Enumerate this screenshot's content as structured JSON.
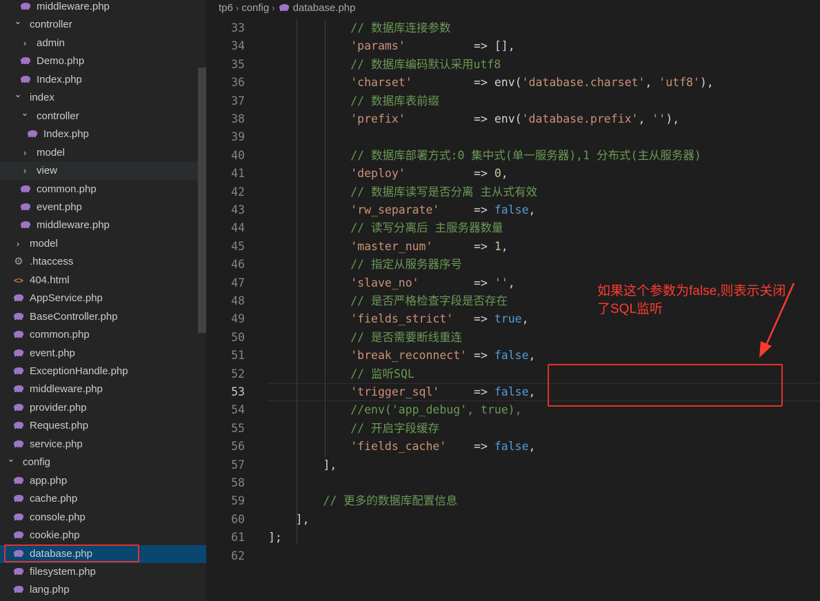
{
  "sidebar": {
    "items": [
      {
        "label": "middleware.php",
        "type": "php",
        "indent": 2
      },
      {
        "label": "controller",
        "type": "folder-open",
        "indent": 1
      },
      {
        "label": "admin",
        "type": "folder-closed",
        "indent": 2
      },
      {
        "label": "Demo.php",
        "type": "php",
        "indent": 2
      },
      {
        "label": "Index.php",
        "type": "php",
        "indent": 2
      },
      {
        "label": "index",
        "type": "folder-open",
        "indent": 1
      },
      {
        "label": "controller",
        "type": "folder-open",
        "indent": 2
      },
      {
        "label": "Index.php",
        "type": "php",
        "indent": 3
      },
      {
        "label": "model",
        "type": "folder-closed",
        "indent": 2
      },
      {
        "label": "view",
        "type": "folder-closed",
        "indent": 2
      },
      {
        "label": "common.php",
        "type": "php",
        "indent": 2
      },
      {
        "label": "event.php",
        "type": "php",
        "indent": 2
      },
      {
        "label": "middleware.php",
        "type": "php",
        "indent": 2
      },
      {
        "label": "model",
        "type": "folder-closed",
        "indent": 1
      },
      {
        "label": ".htaccess",
        "type": "gear",
        "indent": 1
      },
      {
        "label": "404.html",
        "type": "html",
        "indent": 1
      },
      {
        "label": "AppService.php",
        "type": "php",
        "indent": 1
      },
      {
        "label": "BaseController.php",
        "type": "php",
        "indent": 1
      },
      {
        "label": "common.php",
        "type": "php",
        "indent": 1
      },
      {
        "label": "event.php",
        "type": "php",
        "indent": 1
      },
      {
        "label": "ExceptionHandle.php",
        "type": "php",
        "indent": 1
      },
      {
        "label": "middleware.php",
        "type": "php",
        "indent": 1
      },
      {
        "label": "provider.php",
        "type": "php",
        "indent": 1
      },
      {
        "label": "Request.php",
        "type": "php",
        "indent": 1
      },
      {
        "label": "service.php",
        "type": "php",
        "indent": 1
      },
      {
        "label": "config",
        "type": "folder-open",
        "indent": 0
      },
      {
        "label": "app.php",
        "type": "php",
        "indent": 1
      },
      {
        "label": "cache.php",
        "type": "php",
        "indent": 1
      },
      {
        "label": "console.php",
        "type": "php",
        "indent": 1
      },
      {
        "label": "cookie.php",
        "type": "php",
        "indent": 1
      },
      {
        "label": "database.php",
        "type": "php",
        "indent": 1,
        "selected": true
      },
      {
        "label": "filesystem.php",
        "type": "php",
        "indent": 1
      },
      {
        "label": "lang.php",
        "type": "php",
        "indent": 1
      }
    ]
  },
  "breadcrumb": [
    "tp6",
    "config",
    "database.php"
  ],
  "code": [
    {
      "n": "33",
      "tokens": [
        [
          "c-comment",
          "            // 数据库连接参数"
        ]
      ]
    },
    {
      "n": "34",
      "tokens": [
        [
          "c-plain",
          "            "
        ],
        [
          "c-string",
          "'params'"
        ],
        [
          "c-plain",
          "          => [],"
        ]
      ]
    },
    {
      "n": "35",
      "tokens": [
        [
          "c-comment",
          "            // 数据库编码默认采用utf8"
        ]
      ]
    },
    {
      "n": "36",
      "tokens": [
        [
          "c-plain",
          "            "
        ],
        [
          "c-string",
          "'charset'"
        ],
        [
          "c-plain",
          "         => env("
        ],
        [
          "c-string",
          "'database.charset'"
        ],
        [
          "c-plain",
          ", "
        ],
        [
          "c-string",
          "'utf8'"
        ],
        [
          "c-plain",
          "),"
        ]
      ]
    },
    {
      "n": "37",
      "tokens": [
        [
          "c-comment",
          "            // 数据库表前缀"
        ]
      ]
    },
    {
      "n": "38",
      "tokens": [
        [
          "c-plain",
          "            "
        ],
        [
          "c-string",
          "'prefix'"
        ],
        [
          "c-plain",
          "          => env("
        ],
        [
          "c-string",
          "'database.prefix'"
        ],
        [
          "c-plain",
          ", "
        ],
        [
          "c-string",
          "''"
        ],
        [
          "c-plain",
          "),"
        ]
      ]
    },
    {
      "n": "39",
      "tokens": []
    },
    {
      "n": "40",
      "tokens": [
        [
          "c-comment",
          "            // 数据库部署方式:0 集中式(单一服务器),1 分布式(主从服务器)"
        ]
      ]
    },
    {
      "n": "41",
      "tokens": [
        [
          "c-plain",
          "            "
        ],
        [
          "c-string",
          "'deploy'"
        ],
        [
          "c-plain",
          "          => "
        ],
        [
          "c-num",
          "0"
        ],
        [
          "c-plain",
          ","
        ]
      ]
    },
    {
      "n": "42",
      "tokens": [
        [
          "c-comment",
          "            // 数据库读写是否分离 主从式有效"
        ]
      ]
    },
    {
      "n": "43",
      "tokens": [
        [
          "c-plain",
          "            "
        ],
        [
          "c-string",
          "'rw_separate'"
        ],
        [
          "c-plain",
          "     => "
        ],
        [
          "c-kw",
          "false"
        ],
        [
          "c-plain",
          ","
        ]
      ]
    },
    {
      "n": "44",
      "tokens": [
        [
          "c-comment",
          "            // 读写分离后 主服务器数量"
        ]
      ]
    },
    {
      "n": "45",
      "tokens": [
        [
          "c-plain",
          "            "
        ],
        [
          "c-string",
          "'master_num'"
        ],
        [
          "c-plain",
          "      => "
        ],
        [
          "c-num",
          "1"
        ],
        [
          "c-plain",
          ","
        ]
      ]
    },
    {
      "n": "46",
      "tokens": [
        [
          "c-comment",
          "            // 指定从服务器序号"
        ]
      ]
    },
    {
      "n": "47",
      "tokens": [
        [
          "c-plain",
          "            "
        ],
        [
          "c-string",
          "'slave_no'"
        ],
        [
          "c-plain",
          "        => "
        ],
        [
          "c-string",
          "''"
        ],
        [
          "c-plain",
          ","
        ]
      ]
    },
    {
      "n": "48",
      "tokens": [
        [
          "c-comment",
          "            // 是否严格检查字段是否存在"
        ]
      ]
    },
    {
      "n": "49",
      "tokens": [
        [
          "c-plain",
          "            "
        ],
        [
          "c-string",
          "'fields_strict'"
        ],
        [
          "c-plain",
          "   => "
        ],
        [
          "c-kw",
          "true"
        ],
        [
          "c-plain",
          ","
        ]
      ]
    },
    {
      "n": "50",
      "tokens": [
        [
          "c-comment",
          "            // 是否需要断线重连"
        ]
      ]
    },
    {
      "n": "51",
      "tokens": [
        [
          "c-plain",
          "            "
        ],
        [
          "c-string",
          "'break_reconnect'"
        ],
        [
          "c-plain",
          " => "
        ],
        [
          "c-kw",
          "false"
        ],
        [
          "c-plain",
          ","
        ]
      ]
    },
    {
      "n": "52",
      "tokens": [
        [
          "c-comment",
          "            // 监听SQL"
        ]
      ]
    },
    {
      "n": "53",
      "tokens": [
        [
          "c-plain",
          "            "
        ],
        [
          "c-string",
          "'trigger_sql'"
        ],
        [
          "c-plain",
          "     => "
        ],
        [
          "c-kw",
          "false"
        ],
        [
          "c-plain",
          ","
        ]
      ],
      "current": true
    },
    {
      "n": "54",
      "tokens": [
        [
          "c-comment",
          "            //env('app_debug', true),"
        ]
      ]
    },
    {
      "n": "55",
      "tokens": [
        [
          "c-comment",
          "            // 开启字段缓存"
        ]
      ]
    },
    {
      "n": "56",
      "tokens": [
        [
          "c-plain",
          "            "
        ],
        [
          "c-string",
          "'fields_cache'"
        ],
        [
          "c-plain",
          "    => "
        ],
        [
          "c-kw",
          "false"
        ],
        [
          "c-plain",
          ","
        ]
      ]
    },
    {
      "n": "57",
      "tokens": [
        [
          "c-plain",
          "        ],"
        ]
      ]
    },
    {
      "n": "58",
      "tokens": []
    },
    {
      "n": "59",
      "tokens": [
        [
          "c-comment",
          "        // 更多的数据库配置信息"
        ]
      ]
    },
    {
      "n": "60",
      "tokens": [
        [
          "c-plain",
          "    ],"
        ]
      ]
    },
    {
      "n": "61",
      "tokens": [
        [
          "c-plain",
          "];"
        ]
      ]
    },
    {
      "n": "62",
      "tokens": []
    }
  ],
  "annotation": {
    "line1": "如果这个参数为false,则表示关闭",
    "line2": "了SQL监听",
    "color": "#ff3b30"
  },
  "colors": {
    "highlight_box": "#e5312a",
    "selection": "#094771"
  }
}
